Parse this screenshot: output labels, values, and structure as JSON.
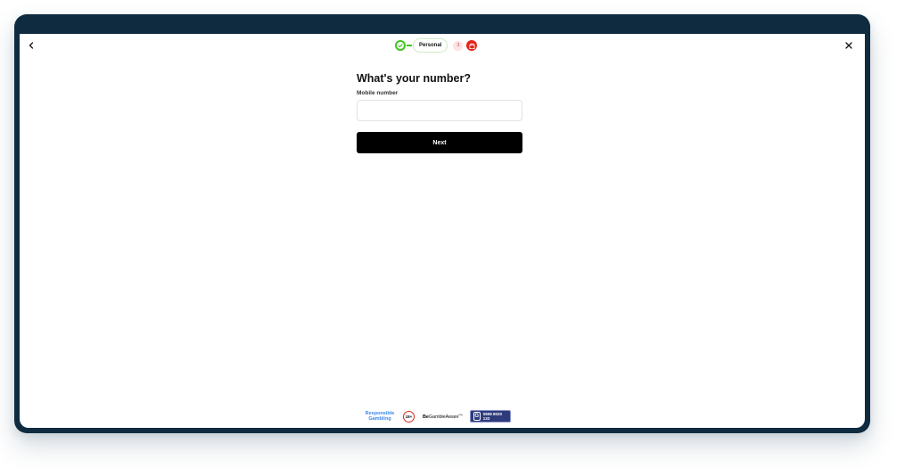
{
  "nav": {
    "back_icon": "chevron-left-icon",
    "close_icon": "close-icon"
  },
  "stepper": {
    "completed_icon": "check-icon",
    "current_label": "Personal",
    "pending_label": "3",
    "final_icon": "gift-icon",
    "colors": {
      "completed": "#3ec61c",
      "final": "#e1261c"
    }
  },
  "form": {
    "title": "What's your number?",
    "field_label": "Mobile number",
    "mobile_value": "",
    "mobile_placeholder": "",
    "next_label": "Next"
  },
  "footer": {
    "responsible_line1": "Responsible",
    "responsible_line2": "Gambling",
    "age_badge": "18+",
    "begambleaware_bold": "Be",
    "begambleaware_rest": "GambleAware",
    "begambleaware_suffix": "org",
    "gamcare_letter": "G",
    "gamcare_phone": "0808 8020 133"
  },
  "colors": {
    "frame": "#0f2b40",
    "button": "#000000"
  }
}
